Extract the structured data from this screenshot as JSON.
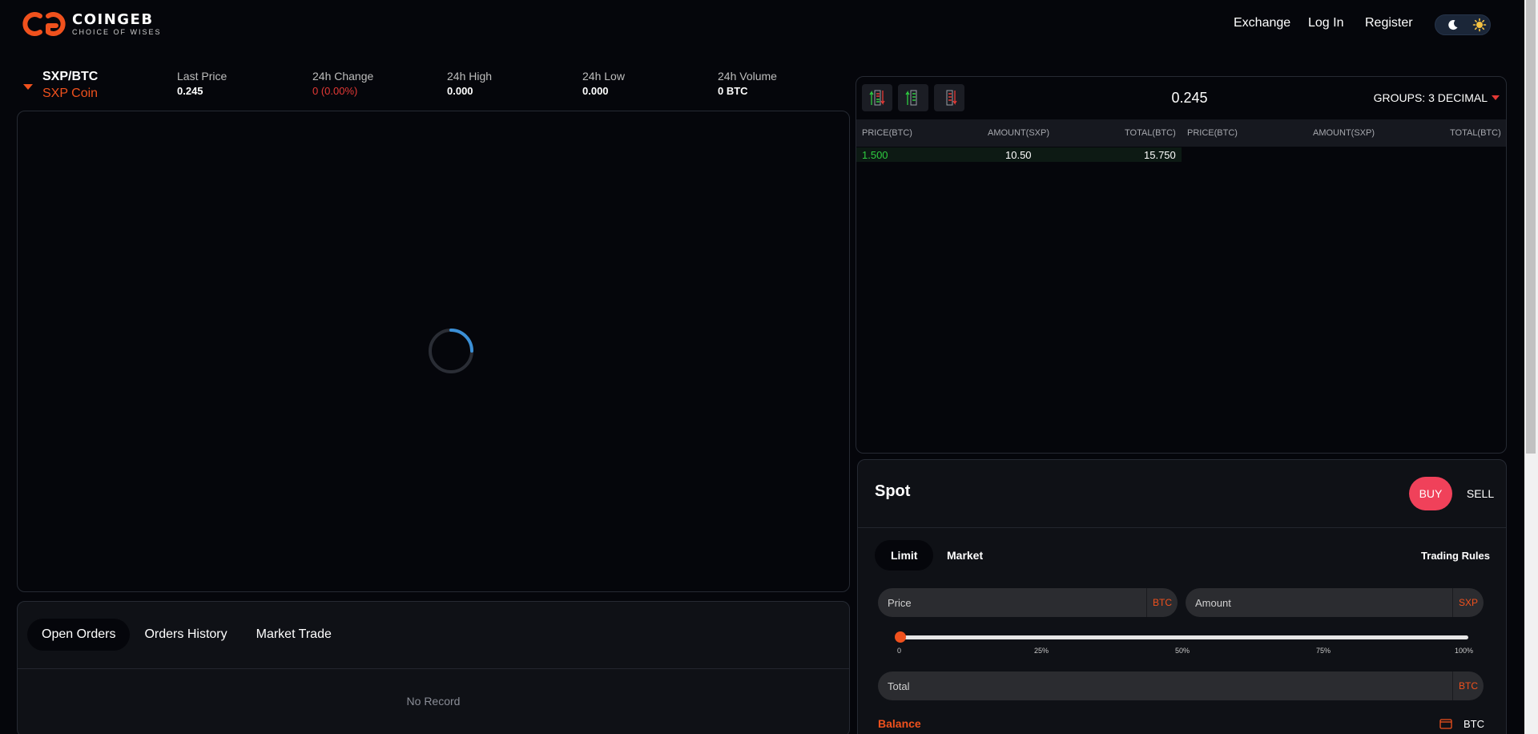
{
  "brand": {
    "name": "COINGEB",
    "tagline": "CHOICE OF WISES",
    "accent": "#f0511d"
  },
  "nav": {
    "exchange": "Exchange",
    "login": "Log In",
    "register": "Register"
  },
  "theme_toggle": {
    "left_icon": "moon-icon",
    "right_icon": "sun-icon"
  },
  "pair": {
    "symbol": "SXP/BTC",
    "coin_name": "SXP Coin"
  },
  "stats": {
    "last_price": {
      "label": "Last Price",
      "value": "0.245"
    },
    "change_24h": {
      "label": "24h Change",
      "value": "0 (0.00%)"
    },
    "high_24h": {
      "label": "24h High",
      "value": "0.000"
    },
    "low_24h": {
      "label": "24h Low",
      "value": "0.000"
    },
    "volume_24h": {
      "label": "24h Volume",
      "value": "0 BTC"
    }
  },
  "chart": {
    "state": "loading"
  },
  "orders": {
    "tabs": [
      "Open Orders",
      "Orders History",
      "Market Trade"
    ],
    "active_tab": "Open Orders",
    "empty_text": "No Record"
  },
  "orderbook": {
    "current_price": "0.245",
    "groups_label": "GROUPS: 3 DECIMAL",
    "view_buttons": [
      "both-book-icon",
      "buy-book-icon",
      "sell-book-icon"
    ],
    "columns": [
      "PRICE(BTC)",
      "AMOUNT(SXP)",
      "TOTAL(BTC)",
      "PRICE(BTC)",
      "AMOUNT(SXP)",
      "TOTAL(BTC)"
    ],
    "bids": [
      {
        "price": "1.500",
        "amount": "10.50",
        "total": "15.750"
      }
    ],
    "asks": []
  },
  "spot": {
    "title": "Spot",
    "buy": "BUY",
    "sell": "SELL",
    "order_types": [
      "Limit",
      "Market"
    ],
    "active_type": "Limit",
    "trading_rules": "Trading Rules",
    "price_placeholder": "Price",
    "price_unit": "BTC",
    "amount_placeholder": "Amount",
    "amount_unit": "SXP",
    "total_placeholder": "Total",
    "total_unit": "BTC",
    "slider_ticks": [
      "0",
      "25%",
      "50%",
      "75%",
      "100%"
    ],
    "slider_value_percent": 0,
    "balance_label": "Balance",
    "balance_unit": "BTC"
  }
}
